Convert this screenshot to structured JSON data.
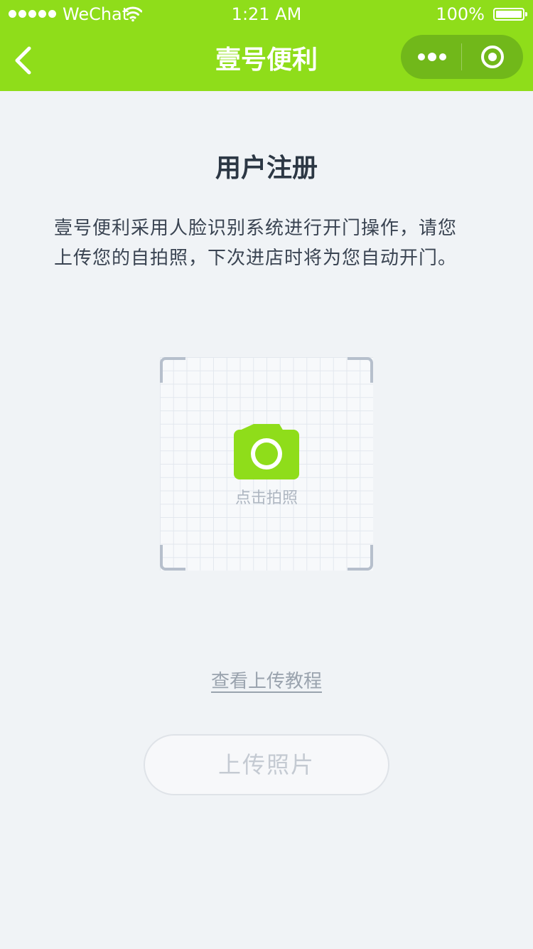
{
  "status_bar": {
    "carrier": "WeChat",
    "time": "1:21 AM",
    "battery": "100%"
  },
  "nav": {
    "title": "壹号便利",
    "back_icon": "chevron-left-icon",
    "more_icon": "more-dots-icon",
    "close_icon": "target-circle-icon"
  },
  "main": {
    "title": "用户注册",
    "intro_lines": [
      "壹号便利采用人脸识别系统进行开门操作，请您",
      "上传您的自拍照，下次进店时将为您自动开门。"
    ],
    "photo": {
      "icon": "camera-icon",
      "label": "点击拍照"
    },
    "tutorial_link": "查看上传教程",
    "upload_button": "上传照片"
  },
  "colors": {
    "brand": "#8fdd1a",
    "capsule": "#71b81a",
    "background": "#f0f3f6",
    "title_text": "#2c3744",
    "muted_text": "#9aa3ae"
  }
}
